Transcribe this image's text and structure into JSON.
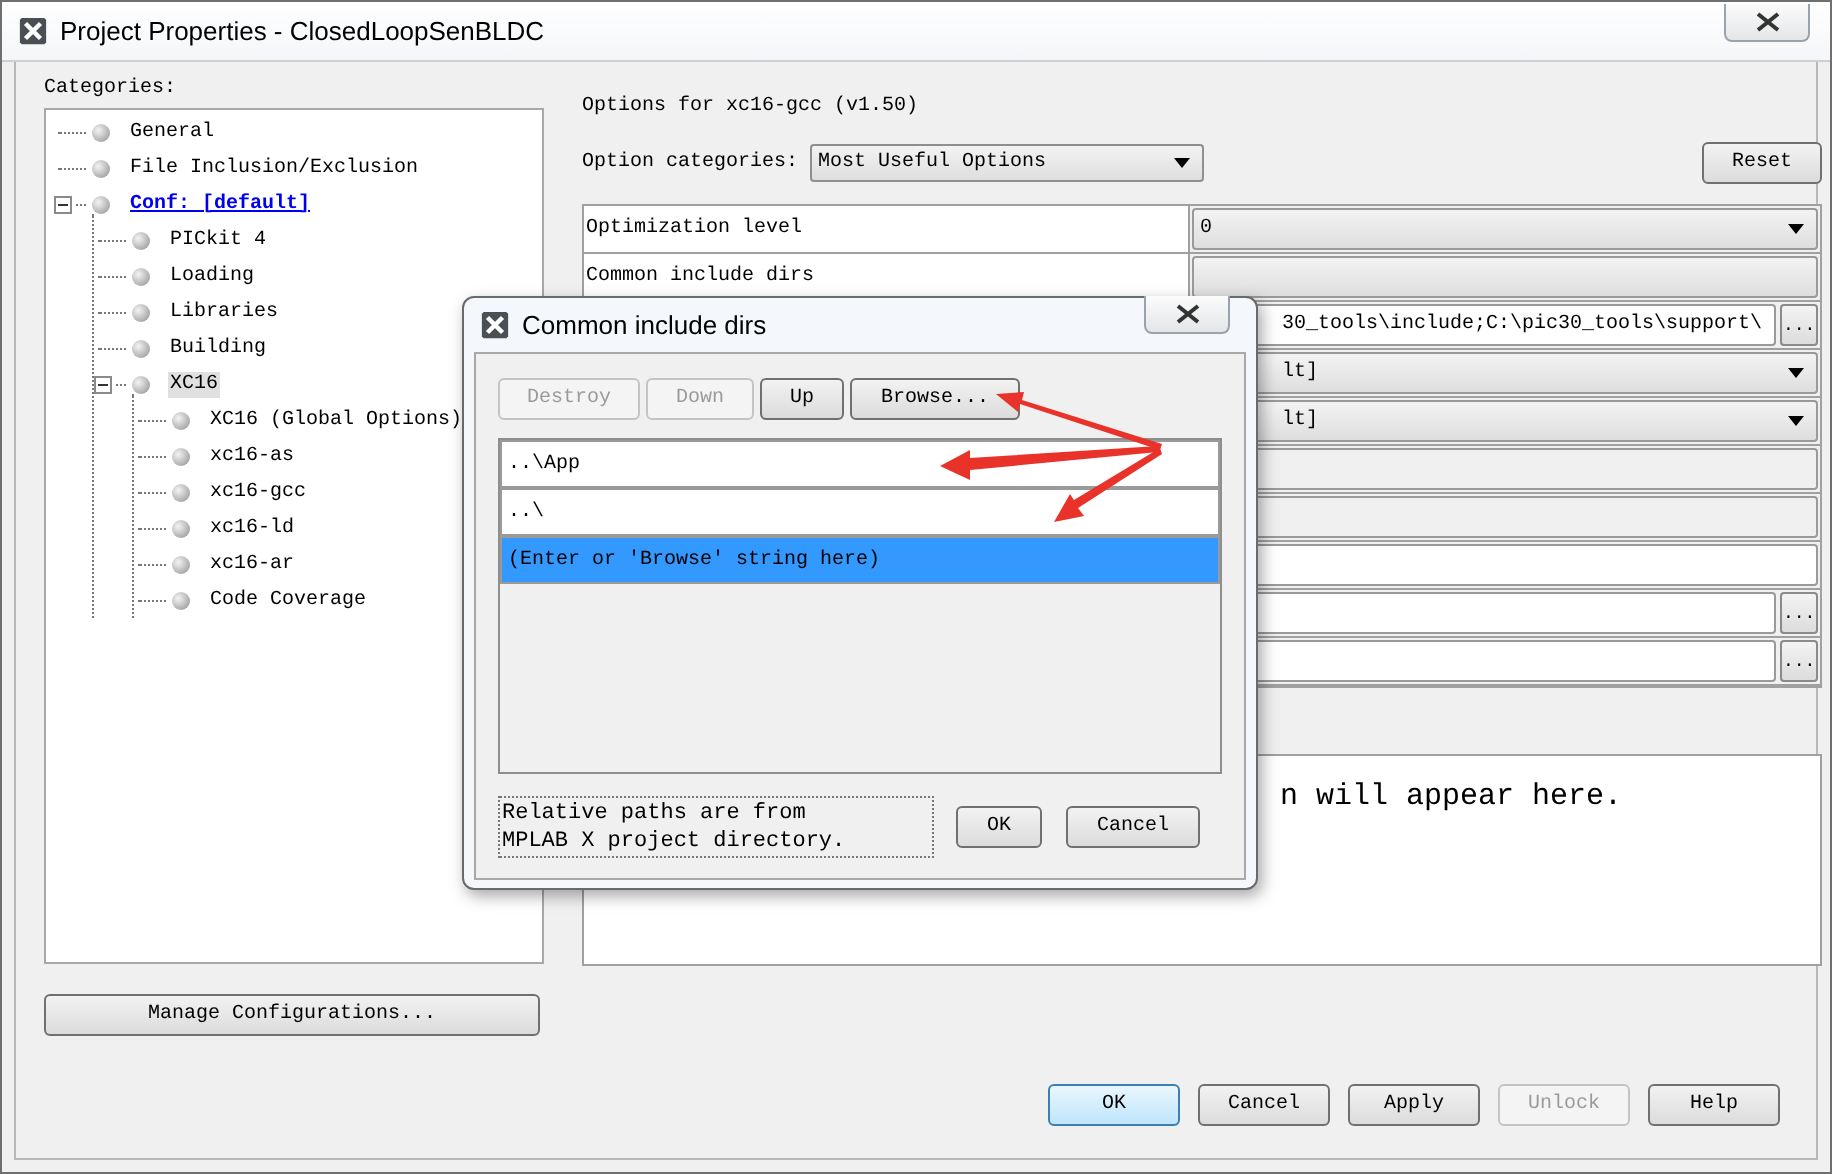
{
  "window": {
    "title": "Project Properties - ClosedLoopSenBLDC"
  },
  "categories": {
    "label": "Categories:",
    "tree": [
      {
        "label": "General",
        "kind": "item",
        "selected": false
      },
      {
        "label": "File Inclusion/Exclusion",
        "kind": "item",
        "selected": false
      },
      {
        "label": "Conf: [default]",
        "kind": "config",
        "selected": false,
        "expanded": true,
        "children": [
          {
            "label": "PICkit 4",
            "kind": "item",
            "selected": false
          },
          {
            "label": "Loading",
            "kind": "item",
            "selected": false
          },
          {
            "label": "Libraries",
            "kind": "item",
            "selected": false
          },
          {
            "label": "Building",
            "kind": "item",
            "selected": false
          },
          {
            "label": "XC16",
            "kind": "item",
            "selected": true,
            "expanded": true,
            "children": [
              {
                "label": "XC16 (Global Options)",
                "kind": "item",
                "selected": false
              },
              {
                "label": "xc16-as",
                "kind": "item",
                "selected": false
              },
              {
                "label": "xc16-gcc",
                "kind": "item",
                "selected": false
              },
              {
                "label": "xc16-ld",
                "kind": "item",
                "selected": false
              },
              {
                "label": "xc16-ar",
                "kind": "item",
                "selected": false
              },
              {
                "label": "Code Coverage",
                "kind": "item",
                "selected": false
              }
            ]
          }
        ]
      }
    ]
  },
  "manage_button": "Manage Configurations...",
  "options": {
    "title": "Options for xc16-gcc (v1.50)",
    "categories_label": "Option categories:",
    "categories_value": "Most Useful Options",
    "reset": "Reset",
    "rows": [
      {
        "label": "Optimization level",
        "kind": "dropdown",
        "value": "0"
      },
      {
        "label": "Common include dirs",
        "kind": "readonly"
      },
      {
        "kind": "browse",
        "value": "30_tools\\include;C:\\pic30_tools\\support\\",
        "browse": "..."
      },
      {
        "kind": "dropdown",
        "value": "lt]"
      },
      {
        "kind": "dropdown",
        "value": "lt]"
      },
      {
        "kind": "empty"
      },
      {
        "kind": "empty"
      },
      {
        "kind": "text"
      },
      {
        "kind": "browse",
        "browse": "..."
      },
      {
        "kind": "browse",
        "browse": "..."
      }
    ],
    "description": "n will appear here."
  },
  "dialog": {
    "title": "Common include dirs",
    "buttons": [
      {
        "label": "Destroy",
        "disabled": true
      },
      {
        "label": "Down",
        "disabled": true
      },
      {
        "label": "Up",
        "disabled": false
      },
      {
        "label": "Browse...",
        "disabled": false
      }
    ],
    "entries": [
      {
        "text": "..\\App",
        "selected": false
      },
      {
        "text": "..\\",
        "selected": false
      },
      {
        "text": "(Enter or 'Browse' string here)",
        "selected": true
      }
    ],
    "note": "Relative paths are from MPLAB X project directory.",
    "actions": [
      "OK",
      "Cancel"
    ]
  },
  "footer_buttons": [
    {
      "label": "OK",
      "default": true,
      "disabled": false
    },
    {
      "label": "Cancel",
      "default": false,
      "disabled": false
    },
    {
      "label": "Apply",
      "default": false,
      "disabled": false
    },
    {
      "label": "Unlock",
      "default": false,
      "disabled": true
    },
    {
      "label": "Help",
      "default": false,
      "disabled": false
    }
  ]
}
